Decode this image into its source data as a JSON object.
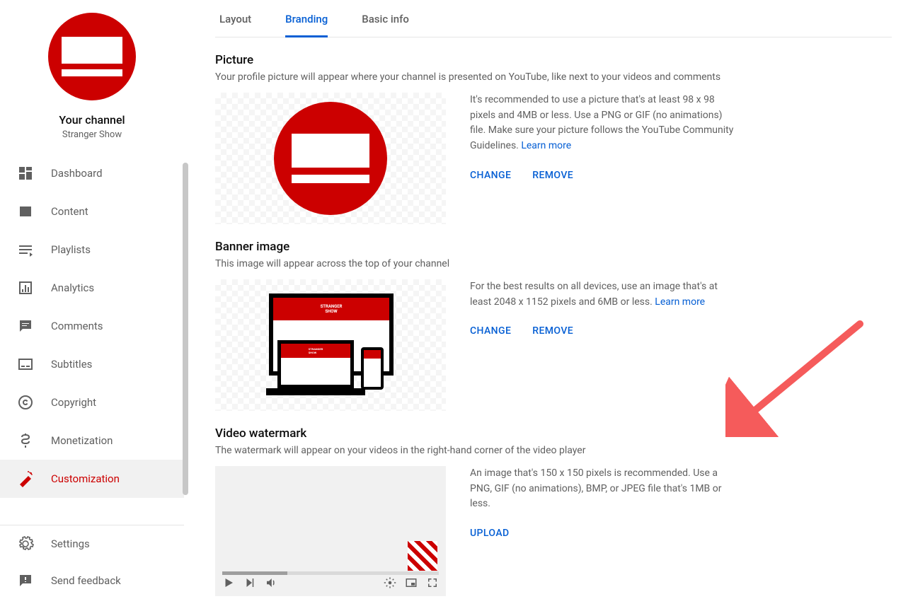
{
  "channel": {
    "your_channel_label": "Your channel",
    "name": "Stranger Show"
  },
  "sidebar": {
    "items": [
      {
        "label": "Dashboard"
      },
      {
        "label": "Content"
      },
      {
        "label": "Playlists"
      },
      {
        "label": "Analytics"
      },
      {
        "label": "Comments"
      },
      {
        "label": "Subtitles"
      },
      {
        "label": "Copyright"
      },
      {
        "label": "Monetization"
      },
      {
        "label": "Customization"
      }
    ],
    "bottom": [
      {
        "label": "Settings"
      },
      {
        "label": "Send feedback"
      }
    ]
  },
  "tabs": {
    "layout": "Layout",
    "branding": "Branding",
    "basic": "Basic info"
  },
  "sections": {
    "picture": {
      "title": "Picture",
      "subtitle": "Your profile picture will appear where your channel is presented on YouTube, like next to your videos and comments",
      "recommend": "It's recommended to use a picture that's at least 98 x 98 pixels and 4MB or less. Use a PNG or GIF (no animations) file. Make sure your picture follows the YouTube Community Guidelines. ",
      "learn_more": "Learn more",
      "change": "CHANGE",
      "remove": "REMOVE"
    },
    "banner": {
      "title": "Banner image",
      "subtitle": "This image will appear across the top of your channel",
      "recommend": "For the best results on all devices, use an image that's at least 2048 x 1152 pixels and 6MB or less. ",
      "learn_more": "Learn more",
      "change": "CHANGE",
      "remove": "REMOVE",
      "banner_text": "STRANGER SHOW"
    },
    "watermark": {
      "title": "Video watermark",
      "subtitle": "The watermark will appear on your videos in the right-hand corner of the video player",
      "recommend": "An image that's 150 x 150 pixels is recommended. Use a PNG, GIF (no animations), BMP, or JPEG file that's 1MB or less.",
      "upload": "UPLOAD"
    }
  }
}
